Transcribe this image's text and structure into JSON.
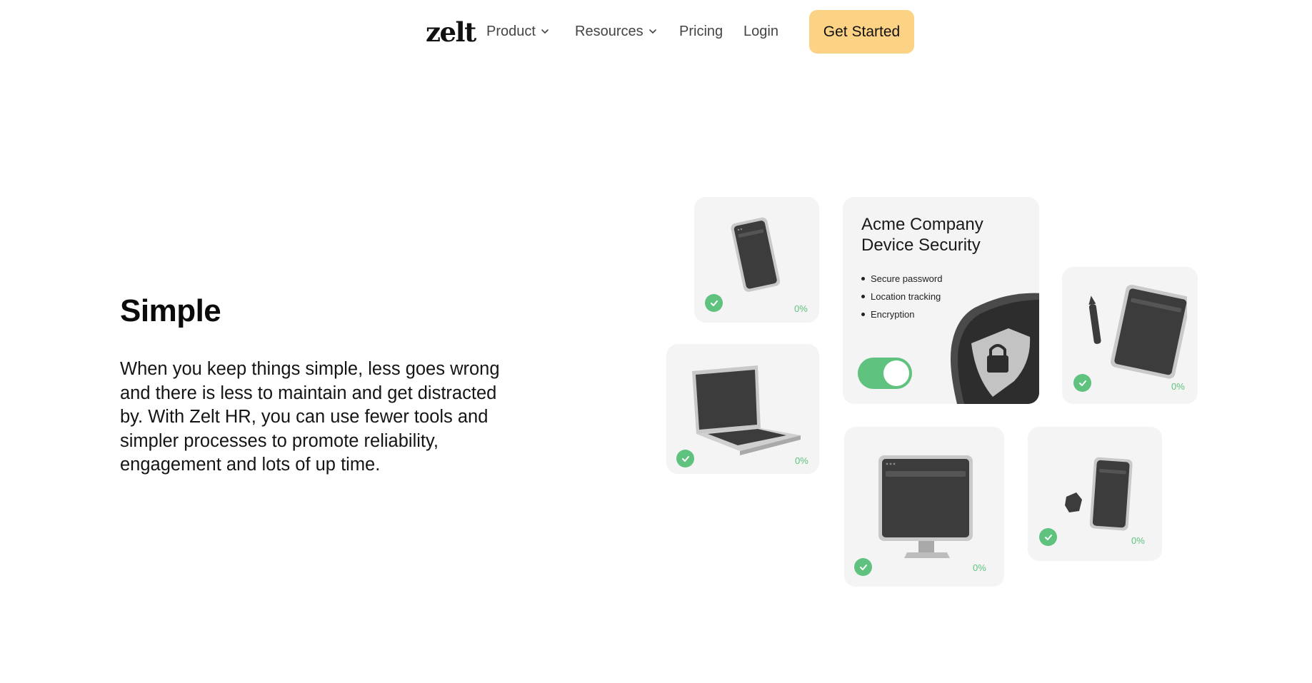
{
  "nav": {
    "logo": "zelt",
    "items": [
      {
        "label": "Product"
      },
      {
        "label": "Resources"
      },
      {
        "label": "Pricing"
      },
      {
        "label": "Login"
      }
    ],
    "cta": "Get Started"
  },
  "hero": {
    "heading": "Simple",
    "body": "When you keep things simple, less goes wrong and there is less to maintain and get distracted by. With Zelt HR, you can use fewer tools and simpler processes to promote reliability, engagement and lots of up time."
  },
  "security_card": {
    "title_line1": "Acme Company",
    "title_line2": "Device Security",
    "features": [
      "Secure password",
      "Location tracking",
      "Encryption"
    ],
    "toggle_on": true
  },
  "devices": [
    {
      "name": "phone",
      "progress": "0%"
    },
    {
      "name": "laptop",
      "progress": "0%"
    },
    {
      "name": "tablet",
      "progress": "0%"
    },
    {
      "name": "monitor",
      "progress": "0%"
    },
    {
      "name": "phone-with-accessory",
      "progress": "0%"
    }
  ],
  "colors": {
    "accent": "#fcd384",
    "success": "#5fc27e",
    "card": "#f4f4f4"
  }
}
